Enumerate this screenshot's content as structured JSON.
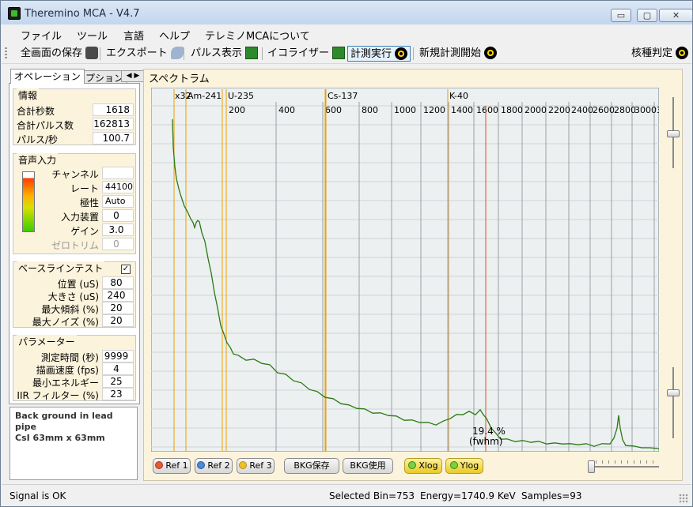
{
  "window": {
    "title": "Theremino MCA - V4.7",
    "controls": {
      "minimize": "▭",
      "maximize": "▢",
      "close": "✕"
    }
  },
  "menu": [
    "ファイル",
    "ツール",
    "言語",
    "ヘルプ",
    "テレミノMCAについて"
  ],
  "toolbar": {
    "save_screen": "全画面の保存",
    "export": "エクスポート",
    "pulse_display": "パルス表示",
    "equalizer": "イコライザー",
    "run_measure": "計測実行",
    "new_measure": "新規計測開始",
    "isotope_id": "核種判定"
  },
  "tabs": {
    "operation": "オペレーション",
    "options": "オプション",
    "arrows": "◀ ▶"
  },
  "info": {
    "title": "情報",
    "rows": [
      {
        "label": "合計秒数",
        "value": "1618"
      },
      {
        "label": "合計パルス数",
        "value": "162813"
      },
      {
        "label": "パルス/秒",
        "value": "100.7"
      }
    ]
  },
  "audio": {
    "title": "音声入力",
    "rows": [
      {
        "label": "チャンネル",
        "value": ""
      },
      {
        "label": "レート",
        "value": "44100"
      },
      {
        "label": "極性",
        "value": "Auto"
      },
      {
        "label": "入力装置",
        "value": "0"
      },
      {
        "label": "ゲイン",
        "value": "3.0"
      },
      {
        "label": "ゼロトリム",
        "value": "0"
      }
    ]
  },
  "baseline": {
    "title": "ベースラインテスト",
    "checked": "✓",
    "rows": [
      {
        "label": "位置 (uS)",
        "value": "80"
      },
      {
        "label": "大きさ (uS)",
        "value": "240"
      },
      {
        "label": "最大傾斜 (%)",
        "value": "20"
      },
      {
        "label": "最大ノイズ (%)",
        "value": "20"
      }
    ]
  },
  "params": {
    "title": "パラメーター",
    "rows": [
      {
        "label": "測定時間 (秒)",
        "value": "9999"
      },
      {
        "label": "描画速度 (fps)",
        "value": "4"
      },
      {
        "label": "最小エネルギー",
        "value": "25"
      },
      {
        "label": "IIR フィルター (%)",
        "value": "23"
      }
    ]
  },
  "notes": [
    "Back ground in lead pipe",
    "CsI 63mm x 63mm"
  ],
  "spectrum": {
    "title": "スペクトラム",
    "x_ticks": [
      "200",
      "400",
      "600",
      "800",
      "1000",
      "1200",
      "1400",
      "1600",
      "1800",
      "2000",
      "2200",
      "2400",
      "2600",
      "2800",
      "3000",
      "3"
    ],
    "markers": [
      "x32",
      "Am-241",
      "U-235",
      "Cs-137",
      "K-40"
    ],
    "fwhm_value": "19.4 %",
    "fwhm_label": "(fwhm)",
    "colors": {
      "plot_bg": "#ecf0f0",
      "grid": "#9aa0a8",
      "trace": "#2a7a12",
      "marker": "#f0a000",
      "cursor": "#e05020"
    }
  },
  "buttons": {
    "ref1": "Ref 1",
    "ref2": "Ref 2",
    "ref3": "Ref 3",
    "bkg_save": "BKG保存",
    "bkg_use": "BKG使用",
    "xlog": "Xlog",
    "ylog": "Ylog"
  },
  "status": {
    "signal": "Signal is OK",
    "bin": "Selected Bin=753",
    "energy": "Energy=1740.9 KeV",
    "samples": "Samples=93"
  }
}
